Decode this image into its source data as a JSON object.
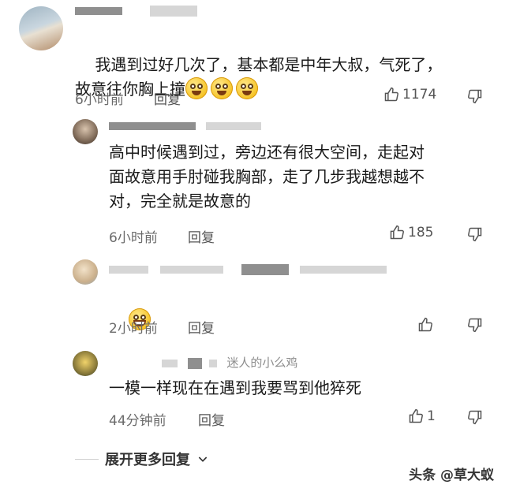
{
  "comments": [
    {
      "text": "我遇到过好几次了，基本都是中年大叔，气死了，\n故意往你胸上撞",
      "time": "6小时前",
      "reply": "回复",
      "likes": "1174"
    },
    {
      "text": "高中时候遇到过，旁边还有很大空间，走起对\n面故意用手肘碰我胸部，走了几步我越想越不\n对，完全就是故意的",
      "time": "6小时前",
      "reply": "回复",
      "likes": "185"
    },
    {
      "time": "2小时前",
      "reply": "回复",
      "likes": ""
    },
    {
      "username_partial": "迷人的小么鸡",
      "text": "一模一样现在在遇到我要骂到他猝死",
      "time": "44分钟前",
      "reply": "回复",
      "likes": "1"
    }
  ],
  "expand_label": "展开更多回复",
  "watermark": "头条 @草大蚁",
  "icons": [
    "thumb-up-icon",
    "thumb-down-icon",
    "chevron-down-icon",
    "grin-emoji-icon"
  ]
}
